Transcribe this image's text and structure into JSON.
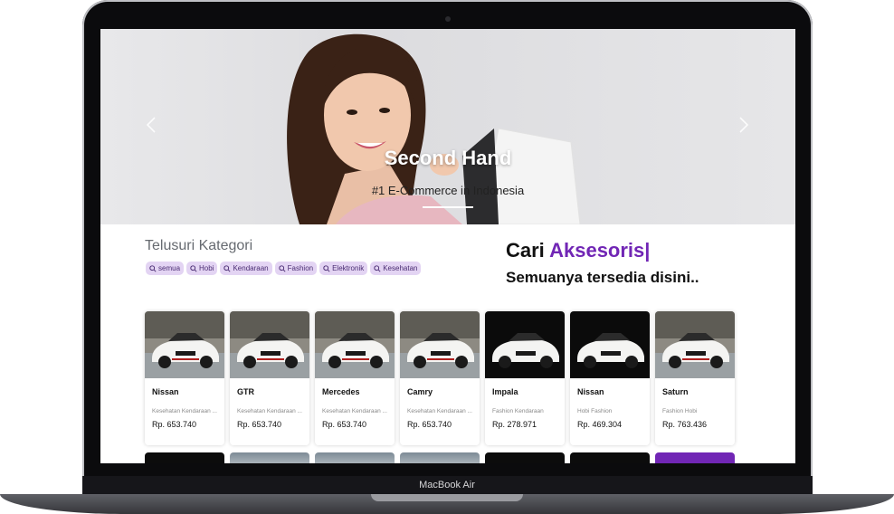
{
  "device": {
    "label": "MacBook Air"
  },
  "hero": {
    "title": "Second Hand",
    "subtitle": "#1 E-Commerce in Indonesia",
    "prev_icon": "chevron-left-icon",
    "next_icon": "chevron-right-icon"
  },
  "categories": {
    "title": "Telusuri Kategori",
    "chips": [
      "semua",
      "Hobi",
      "Kendaraan",
      "Fashion",
      "Elektronik",
      "Kesehatan"
    ]
  },
  "search_prompt": {
    "prefix": "Cari",
    "highlight": "Aksesoris|",
    "tagline": "Semuanya tersedia disini.."
  },
  "products": [
    {
      "name": "Nissan",
      "category": "Kesehatan Kendaraan ...",
      "price": "Rp. 653.740",
      "photo": "light"
    },
    {
      "name": "GTR",
      "category": "Kesehatan Kendaraan ...",
      "price": "Rp. 653.740",
      "photo": "light"
    },
    {
      "name": "Mercedes",
      "category": "Kesehatan Kendaraan ...",
      "price": "Rp. 653.740",
      "photo": "light"
    },
    {
      "name": "Camry",
      "category": "Kesehatan Kendaraan ...",
      "price": "Rp. 653.740",
      "photo": "light"
    },
    {
      "name": "Impala",
      "category": "Fashion Kendaraan",
      "price": "Rp. 278.971",
      "photo": "dark"
    },
    {
      "name": "Nissan",
      "category": "Hobi Fashion",
      "price": "Rp. 469.304",
      "photo": "dark"
    },
    {
      "name": "Saturn",
      "category": "Fashion Hobi",
      "price": "Rp. 763.436",
      "photo": "light"
    }
  ],
  "colors": {
    "accent": "#7126b5",
    "chip_bg": "#e3d4f3"
  }
}
